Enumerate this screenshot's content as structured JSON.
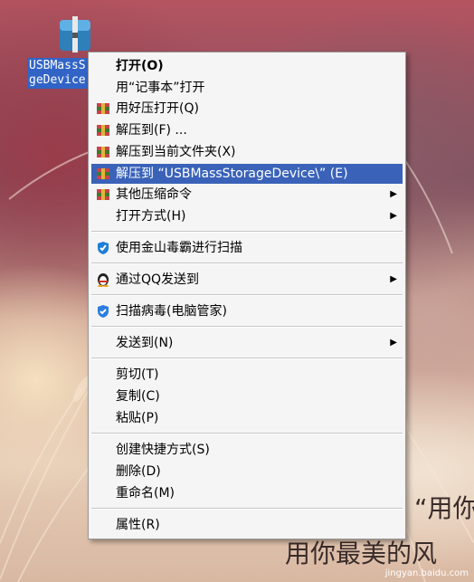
{
  "desktop": {
    "file_name_lines": [
      "USBMassS",
      "geDevice"
    ]
  },
  "menu": {
    "items": [
      {
        "label": "打开(O)",
        "icon": null,
        "bold": true,
        "submenu": false
      },
      {
        "label": "用“记事本”打开",
        "icon": null,
        "submenu": false
      },
      {
        "label": "用好压打开(Q)",
        "icon": "haozip-icon",
        "submenu": false
      },
      {
        "label": "解压到(F) ...",
        "icon": "haozip-icon",
        "submenu": false
      },
      {
        "label": "解压到当前文件夹(X)",
        "icon": "haozip-icon",
        "submenu": false
      },
      {
        "label": "解压到 “USBMassStorageDevice\\” (E)",
        "icon": "haozip-icon",
        "submenu": false,
        "highlighted": true
      },
      {
        "label": "其他压缩命令",
        "icon": "haozip-icon",
        "submenu": true
      },
      {
        "label": "打开方式(H)",
        "icon": null,
        "submenu": true
      },
      {
        "label": "使用金山毒霸进行扫描",
        "icon": "kingsoft-antivirus-icon",
        "submenu": false
      },
      {
        "label": "通过QQ发送到",
        "icon": "qq-penguin-icon",
        "submenu": true
      },
      {
        "label": "扫描病毒(电脑管家)",
        "icon": "tencent-shield-icon",
        "submenu": false
      },
      {
        "label": "发送到(N)",
        "icon": null,
        "submenu": true
      },
      {
        "label": "剪切(T)",
        "icon": null,
        "submenu": false
      },
      {
        "label": "复制(C)",
        "icon": null,
        "submenu": false
      },
      {
        "label": "粘贴(P)",
        "icon": null,
        "submenu": false
      },
      {
        "label": "创建快捷方式(S)",
        "icon": null,
        "submenu": false
      },
      {
        "label": "删除(D)",
        "icon": null,
        "submenu": false
      },
      {
        "label": "重命名(M)",
        "icon": null,
        "submenu": false
      },
      {
        "label": "属性(R)",
        "icon": null,
        "submenu": false
      }
    ],
    "highlight_color": "#3a62b8"
  },
  "background_text": {
    "line1": "“用你",
    "line2": "用你最美的风"
  },
  "watermark": "jingyan.baidu.com"
}
